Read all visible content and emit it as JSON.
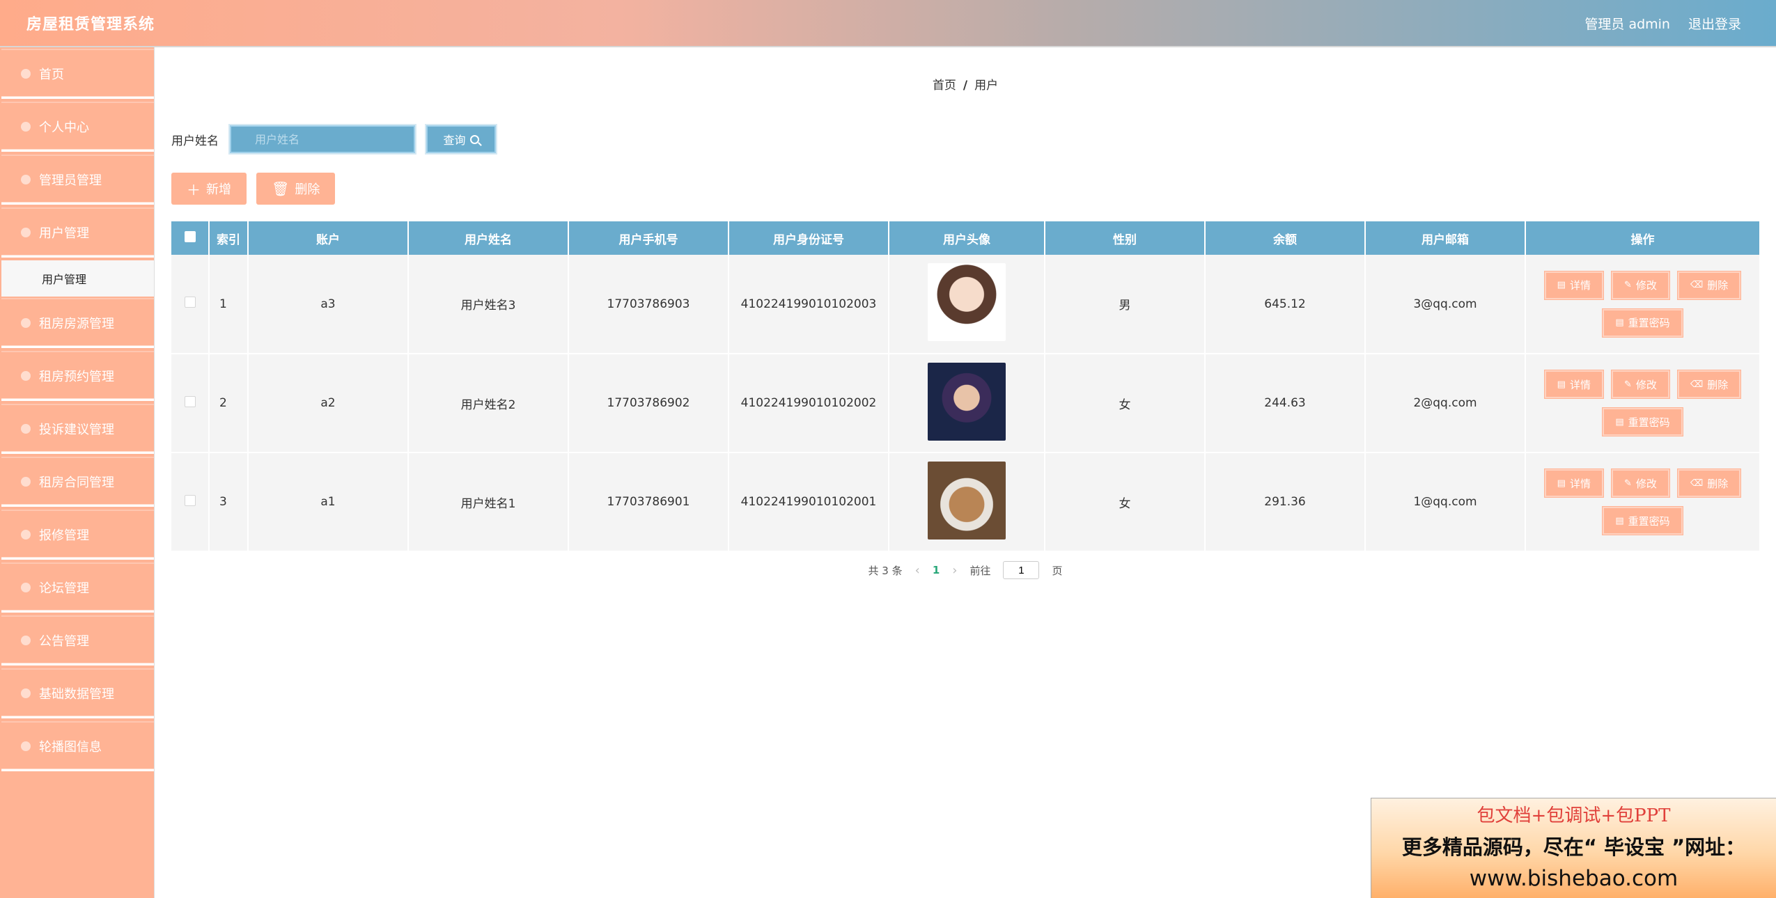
{
  "header": {
    "title": "房屋租赁管理系统",
    "user": "管理员 admin",
    "logout": "退出登录"
  },
  "sidebar": {
    "items": [
      {
        "label": "首页"
      },
      {
        "label": "个人中心"
      },
      {
        "label": "管理员管理"
      },
      {
        "label": "用户管理"
      },
      {
        "label": "租房房源管理"
      },
      {
        "label": "租房预约管理"
      },
      {
        "label": "投诉建议管理"
      },
      {
        "label": "租房合同管理"
      },
      {
        "label": "报修管理"
      },
      {
        "label": "论坛管理"
      },
      {
        "label": "公告管理"
      },
      {
        "label": "基础数据管理"
      },
      {
        "label": "轮播图信息"
      }
    ],
    "submenu": "用户管理"
  },
  "breadcrumb": {
    "home": "首页",
    "sep": "/",
    "current": "用户"
  },
  "search": {
    "label": "用户姓名",
    "placeholder": "用户姓名",
    "button": "查询"
  },
  "actions": {
    "add": "新增",
    "delete": "删除"
  },
  "table": {
    "columns": [
      "索引",
      "账户",
      "用户姓名",
      "用户手机号",
      "用户身份证号",
      "用户头像",
      "性别",
      "余额",
      "用户邮箱",
      "操作"
    ],
    "rows": [
      {
        "index": "1",
        "account": "a3",
        "name": "用户姓名3",
        "phone": "17703786903",
        "idcard": "410224199010102003",
        "gender": "男",
        "balance": "645.12",
        "email": "3@qq.com"
      },
      {
        "index": "2",
        "account": "a2",
        "name": "用户姓名2",
        "phone": "17703786902",
        "idcard": "410224199010102002",
        "gender": "女",
        "balance": "244.63",
        "email": "2@qq.com"
      },
      {
        "index": "3",
        "account": "a1",
        "name": "用户姓名1",
        "phone": "17703786901",
        "idcard": "410224199010102001",
        "gender": "女",
        "balance": "291.36",
        "email": "1@qq.com"
      }
    ],
    "ops": {
      "detail": "详情",
      "edit": "修改",
      "remove": "删除",
      "reset": "重置密码"
    }
  },
  "pagination": {
    "total": "共 3 条",
    "current": "1",
    "goto": "前往",
    "page_value": "1",
    "page_suffix": "页"
  },
  "watermark": {
    "line1": "包文档+包调试+包PPT",
    "line2": "更多精品源码，尽在“ 毕设宝 ”网址：",
    "line3": "www.bishebao.com"
  },
  "colors": {
    "accent": "#ffb394",
    "primary": "#6aaccd"
  }
}
